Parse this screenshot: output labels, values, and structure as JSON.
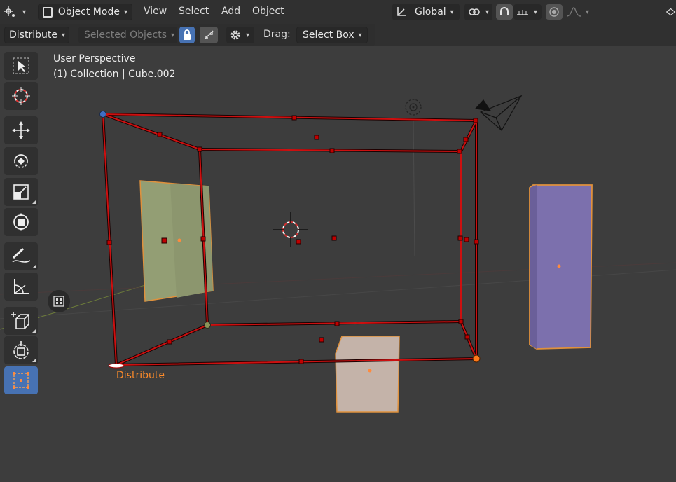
{
  "header": {
    "editor_type_icon": "editor-type-icon",
    "mode_label": "Object Mode",
    "menus": [
      "View",
      "Select",
      "Add",
      "Object"
    ],
    "orientation_label": "Global"
  },
  "tool_settings": {
    "tool_label": "Distribute",
    "selected_objects_label": "Selected Objects",
    "drag_label": "Drag:",
    "drag_value": "Select Box"
  },
  "viewport": {
    "perspective_label": "User Perspective",
    "collection_label": "(1) Collection | Cube.002",
    "distribute_label": "Distribute"
  },
  "toolbar": {
    "tools": [
      "select-box-tool",
      "cursor-tool",
      "move-tool",
      "rotate-tool",
      "scale-tool",
      "transform-tool",
      "annotate-tool",
      "measure-tool",
      "add-cube-tool",
      "spin-tool",
      "distribute-tool"
    ],
    "active_tool": "distribute-tool"
  },
  "colors": {
    "selection_red": "#cc0000",
    "active_orange": "#ff7f1f",
    "header_bg": "#303030",
    "viewport_bg": "#3d3d3d",
    "active_blue": "#4772b3"
  }
}
